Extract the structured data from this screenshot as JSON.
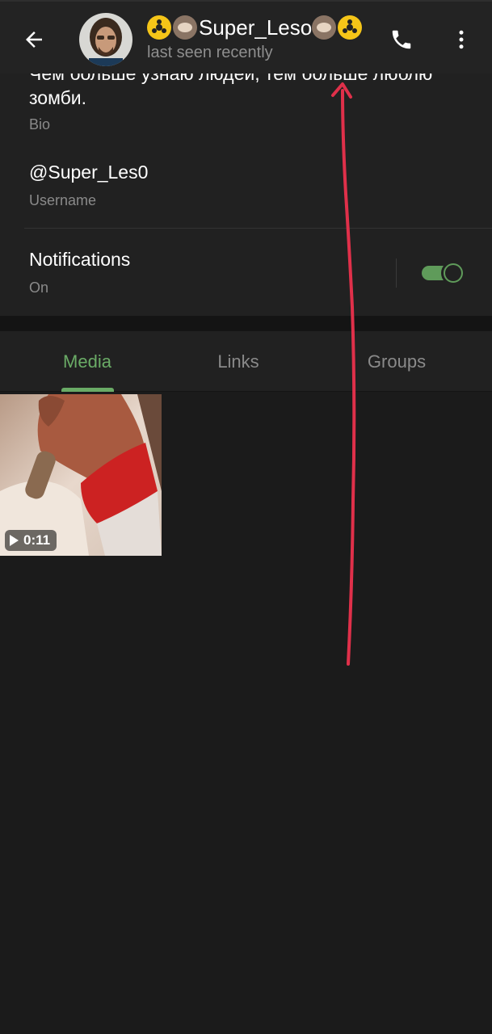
{
  "header": {
    "title": "Super_Leso",
    "title_emojis_left": [
      "radioactive-emoji",
      "sloth-emoji"
    ],
    "title_emojis_right": [
      "sloth-emoji",
      "radioactive-emoji"
    ],
    "status": "last seen recently"
  },
  "info": {
    "bio_text": "Чем больше узнаю людей, тем больше люблю зомби.",
    "bio_label": "Bio",
    "username": "@Super_Les0",
    "username_label": "Username",
    "notifications_title": "Notifications",
    "notifications_state": "On",
    "notifications_enabled": true
  },
  "tabs": [
    {
      "label": "Media",
      "active": true
    },
    {
      "label": "Links",
      "active": false
    },
    {
      "label": "Groups",
      "active": false
    }
  ],
  "media": [
    {
      "type": "video",
      "duration": "0:11"
    }
  ],
  "colors": {
    "accent": "#6aab66",
    "background": "#1b1b1b",
    "surface": "#212121",
    "header": "#232323",
    "annotation": "#e0304a"
  }
}
